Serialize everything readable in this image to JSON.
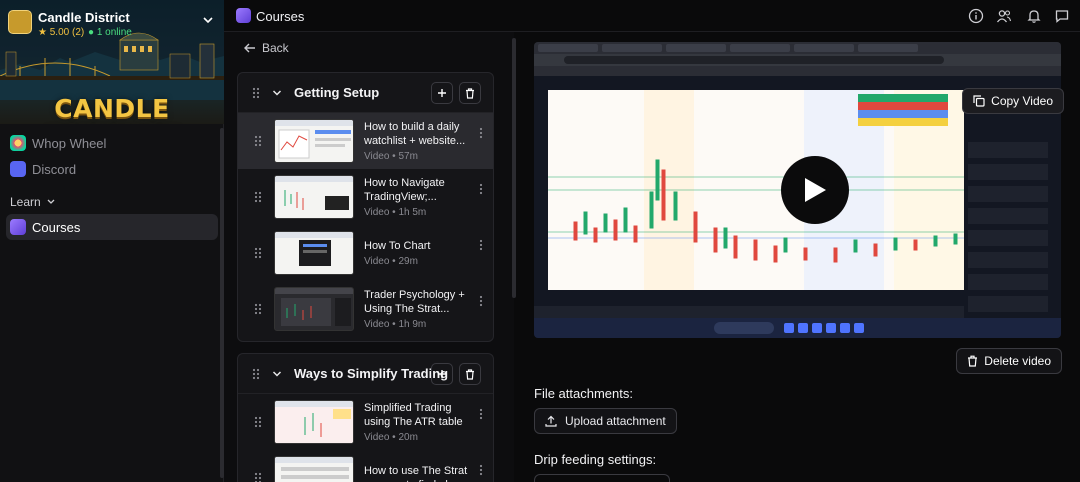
{
  "community": {
    "name": "Candle District",
    "rating": "5.00 (2)",
    "online": "1 online",
    "banner_title": "CANDLE DISTRICT"
  },
  "sidebar": {
    "items": [
      {
        "label": "Whop Wheel",
        "icon": "wheel-icon"
      },
      {
        "label": "Discord",
        "icon": "discord-icon"
      }
    ],
    "section_label": "Learn",
    "courses_label": "Courses"
  },
  "header": {
    "title": "Courses",
    "icons": [
      "info-icon",
      "users-icon",
      "bell-icon",
      "chat-icon"
    ]
  },
  "panel": {
    "back_label": "Back",
    "chapters": [
      {
        "title": "Getting Setup",
        "lessons": [
          {
            "title": "How to build a daily watchlist + website...",
            "meta": "Video • 57m",
            "active": true
          },
          {
            "title": "How to Navigate TradingView;...",
            "meta": "Video • 1h 5m",
            "active": false
          },
          {
            "title": "How To Chart",
            "meta": "Video • 29m",
            "active": false
          },
          {
            "title": "Trader Psychology + Using The Strat...",
            "meta": "Video • 1h 9m",
            "active": false
          }
        ]
      },
      {
        "title": "Ways to Simplify Trading",
        "lessons": [
          {
            "title": "Simplified Trading using The ATR table",
            "meta": "Video • 20m",
            "active": false
          },
          {
            "title": "How to use The Strat scanner to find plays",
            "meta": "",
            "active": false
          }
        ]
      }
    ]
  },
  "main": {
    "copy_video_label": "Copy Video",
    "delete_video_label": "Delete video",
    "attachments_label": "File attachments:",
    "upload_label": "Upload attachment",
    "drip_label": "Drip feeding settings:"
  },
  "colors": {
    "accent_purple": "#8b6cf6",
    "gold": "#f4c542",
    "online_green": "#4ade80",
    "candle_up": "#22a86b",
    "candle_down": "#e0483e"
  }
}
